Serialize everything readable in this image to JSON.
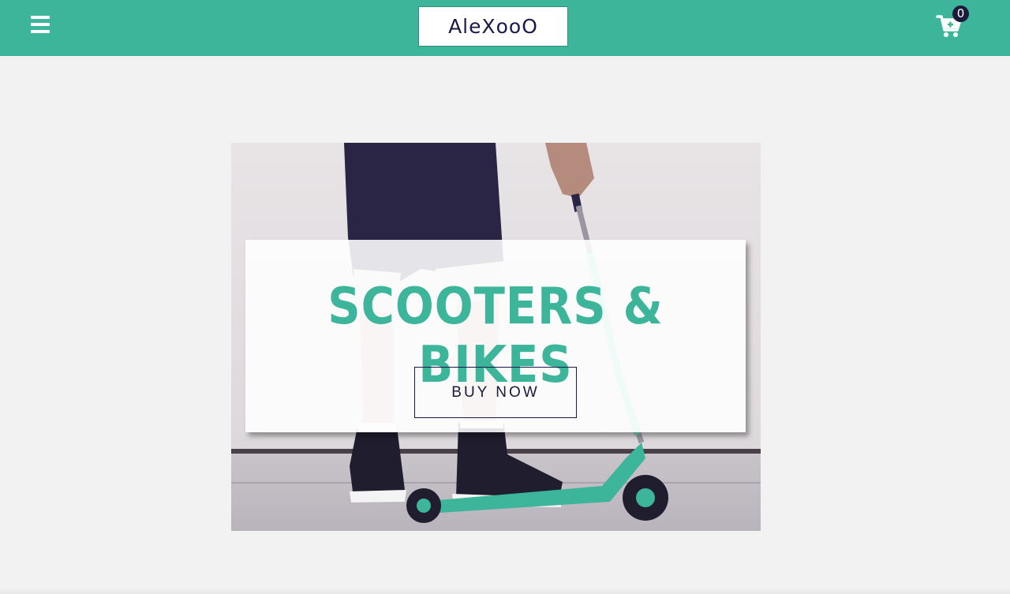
{
  "header": {
    "logo_text": "AleXooO",
    "cart_count": "0",
    "menu_icon": "hamburger-menu-icon",
    "cart_icon": "shopping-cart-plus-icon",
    "bar_color": "#3db59a"
  },
  "hero": {
    "title": "SCOOTERS & BIKES",
    "button_label": "BUY NOW",
    "accent_color": "#3db59a",
    "image_subject": "person-with-kick-scooter-photo"
  }
}
